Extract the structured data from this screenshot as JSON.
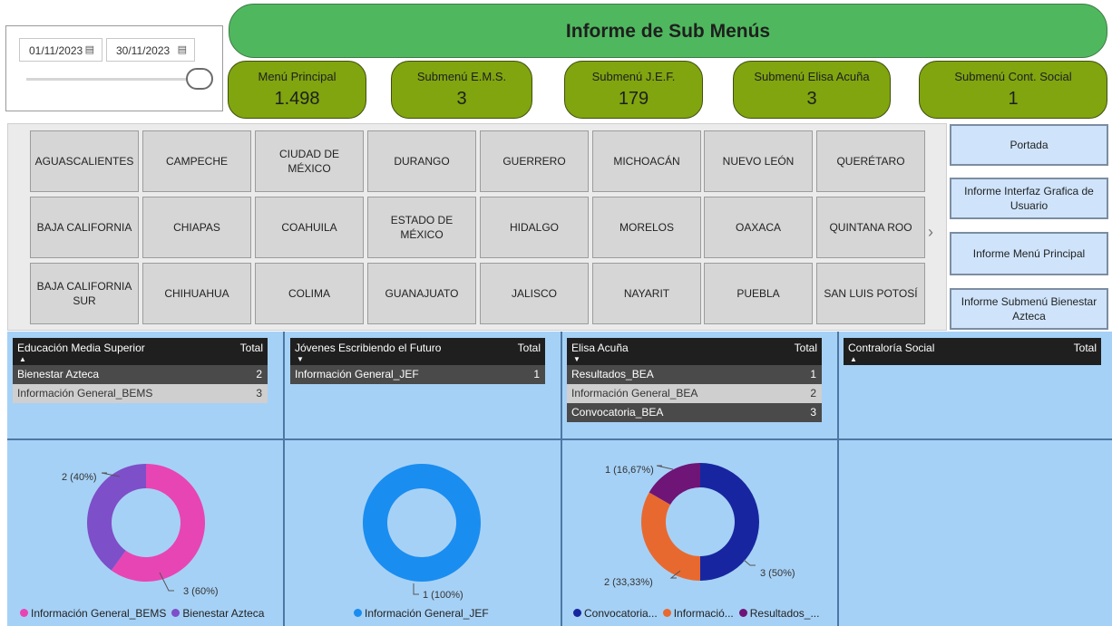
{
  "slicer": {
    "start_date": "01/11/2023",
    "end_date": "30/11/2023"
  },
  "title": "Informe de Sub Menús",
  "kpis": [
    {
      "label": "Menú Principal",
      "value": "1.498"
    },
    {
      "label": "Submenú E.M.S.",
      "value": "3"
    },
    {
      "label": "Submenú J.E.F.",
      "value": "179"
    },
    {
      "label": "Submenú Elisa Acuña",
      "value": "3"
    },
    {
      "label": "Submenú Cont. Social",
      "value": "1"
    }
  ],
  "states": [
    [
      "AGUASCALIENTES",
      "CAMPECHE",
      "CIUDAD DE MÉXICO",
      "DURANGO",
      "GUERRERO",
      "MICHOACÁN",
      "NUEVO LEÓN",
      "QUERÉTARO"
    ],
    [
      "BAJA CALIFORNIA",
      "CHIAPAS",
      "COAHUILA",
      "ESTADO DE MÉXICO",
      "HIDALGO",
      "MORELOS",
      "OAXACA",
      "QUINTANA ROO"
    ],
    [
      "BAJA CALIFORNIA SUR",
      "CHIHUAHUA",
      "COLIMA",
      "GUANAJUATO",
      "JALISCO",
      "NAYARIT",
      "PUEBLA",
      "SAN LUIS POTOSÍ"
    ]
  ],
  "nav_buttons": [
    "Portada",
    "Informe Interfaz Grafica de Usuario",
    "Informe Menú Principal",
    "Informe Submenú Bienestar Azteca"
  ],
  "tables": [
    {
      "header": "Educación Media Superior",
      "total_label": "Total",
      "sort": "up",
      "rows": [
        {
          "name": "Bienestar Azteca",
          "value": "2"
        },
        {
          "name": "Información General_BEMS",
          "value": "3"
        }
      ]
    },
    {
      "header": "Jóvenes Escribiendo el Futuro",
      "total_label": "Total",
      "sort": "down",
      "rows": [
        {
          "name": "Información General_JEF",
          "value": "1"
        }
      ]
    },
    {
      "header": "Elisa Acuña",
      "total_label": "Total",
      "sort": "down",
      "rows": [
        {
          "name": "Resultados_BEA",
          "value": "1"
        },
        {
          "name": "Información General_BEA",
          "value": "2"
        },
        {
          "name": "Convocatoria_BEA",
          "value": "3"
        }
      ]
    },
    {
      "header": "Contraloría Social",
      "total_label": "Total",
      "sort": "up",
      "rows": []
    }
  ],
  "chart_data": [
    {
      "type": "pie",
      "categories": [
        "Información General_BEMS",
        "Bienestar Azteca"
      ],
      "values": [
        3,
        2
      ],
      "data_labels": [
        "3 (60%)",
        "2 (40%)"
      ],
      "colors": [
        "#e845b4",
        "#7d4fc8"
      ],
      "legend": [
        "Información General_BEMS",
        "Bienestar Azteca"
      ],
      "legend_position": "bottom"
    },
    {
      "type": "pie",
      "categories": [
        "Información General_JEF"
      ],
      "values": [
        1
      ],
      "data_labels": [
        "1 (100%)"
      ],
      "colors": [
        "#1a8df0"
      ],
      "legend": [
        "Información General_JEF"
      ],
      "legend_position": "bottom"
    },
    {
      "type": "pie",
      "categories": [
        "Convocatoria_BEA",
        "Información General_BEA",
        "Resultados_BEA"
      ],
      "values": [
        3,
        2,
        1
      ],
      "data_labels": [
        "3 (50%)",
        "2 (33,33%)",
        "1 (16,67%)"
      ],
      "colors": [
        "#1726a0",
        "#e8692f",
        "#6e1577"
      ],
      "legend": [
        "Convocatoria...",
        "Informació...",
        "Resultados_..."
      ],
      "legend_position": "bottom"
    }
  ]
}
